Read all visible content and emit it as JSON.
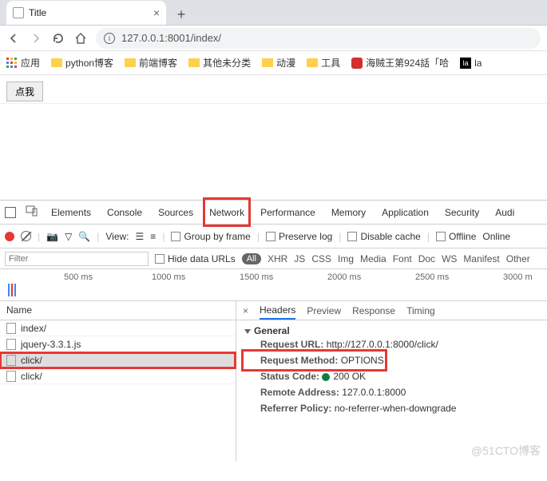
{
  "browser": {
    "tab_title": "Title",
    "new_tab": "+",
    "close": "×",
    "url": "127.0.0.1:8001/index/"
  },
  "bookmarks": {
    "apps": "应用",
    "items": [
      "python博客",
      "前端博客",
      "其他未分类",
      "动漫",
      "工具"
    ],
    "swirl": "海贼王第924話「哈",
    "la": "la"
  },
  "page": {
    "button": "点我"
  },
  "devtools": {
    "tabs": [
      "Elements",
      "Console",
      "Sources",
      "Network",
      "Performance",
      "Memory",
      "Application",
      "Security",
      "Audi"
    ],
    "toolbar": {
      "view": "View:",
      "group": "Group by frame",
      "preserve": "Preserve log",
      "disable": "Disable cache",
      "offline": "Offline",
      "online": "Online"
    },
    "filter": {
      "placeholder": "Filter",
      "hide": "Hide data URLs",
      "all": "All",
      "types": [
        "XHR",
        "JS",
        "CSS",
        "Img",
        "Media",
        "Font",
        "Doc",
        "WS",
        "Manifest",
        "Other"
      ]
    },
    "timeline": [
      "500 ms",
      "1000 ms",
      "1500 ms",
      "2000 ms",
      "2500 ms",
      "3000 m"
    ],
    "reqlist": {
      "header": "Name",
      "rows": [
        "index/",
        "jquery-3.3.1.js",
        "click/",
        "click/"
      ]
    },
    "detail": {
      "tabs": [
        "Headers",
        "Preview",
        "Response",
        "Timing"
      ],
      "general": "General",
      "url_k": "Request URL:",
      "url_v": "http://127.0.0.1:8000/click/",
      "method_k": "Request Method:",
      "method_v": "OPTIONS",
      "status_k": "Status Code:",
      "status_v": "200 OK",
      "remote_k": "Remote Address:",
      "remote_v": "127.0.0.1:8000",
      "ref_k": "Referrer Policy:",
      "ref_v": "no-referrer-when-downgrade"
    }
  },
  "watermark": "@51CTO博客"
}
